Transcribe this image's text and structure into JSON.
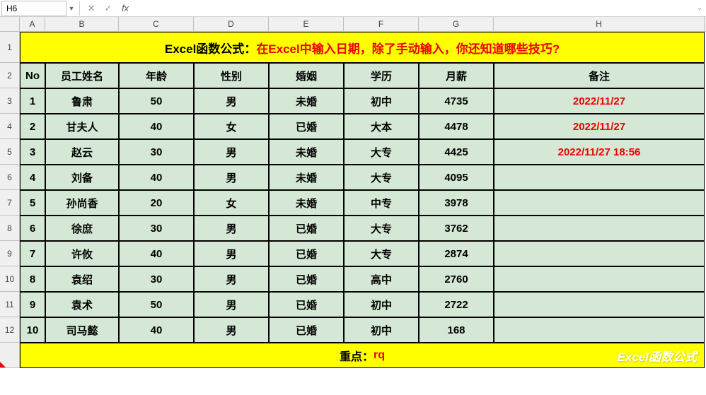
{
  "name_box": "H6",
  "formula": "",
  "col_labels": [
    "A",
    "B",
    "C",
    "D",
    "E",
    "F",
    "G",
    "H"
  ],
  "row_labels": [
    "1",
    "2",
    "3",
    "4",
    "5",
    "6",
    "7",
    "8",
    "9",
    "10",
    "11",
    "12"
  ],
  "title": {
    "prefix": "Excel函数公式：",
    "body": "在Excel中输入日期，除了手动输入，你还知道哪些技巧?"
  },
  "headers": {
    "no": "No",
    "name": "员工姓名",
    "age": "年龄",
    "gender": "性别",
    "marriage": "婚姻",
    "edu": "学历",
    "salary": "月薪",
    "remark": "备注"
  },
  "rows": [
    {
      "no": "1",
      "name": "鲁肃",
      "age": "50",
      "gender": "男",
      "marriage": "未婚",
      "edu": "初中",
      "salary": "4735",
      "remark": "2022/11/27"
    },
    {
      "no": "2",
      "name": "甘夫人",
      "age": "40",
      "gender": "女",
      "marriage": "已婚",
      "edu": "大本",
      "salary": "4478",
      "remark": "2022/11/27"
    },
    {
      "no": "3",
      "name": "赵云",
      "age": "30",
      "gender": "男",
      "marriage": "未婚",
      "edu": "大专",
      "salary": "4425",
      "remark": "2022/11/27 18:56"
    },
    {
      "no": "4",
      "name": "刘备",
      "age": "40",
      "gender": "男",
      "marriage": "未婚",
      "edu": "大专",
      "salary": "4095",
      "remark": ""
    },
    {
      "no": "5",
      "name": "孙尚香",
      "age": "20",
      "gender": "女",
      "marriage": "未婚",
      "edu": "中专",
      "salary": "3978",
      "remark": ""
    },
    {
      "no": "6",
      "name": "徐庶",
      "age": "30",
      "gender": "男",
      "marriage": "已婚",
      "edu": "大专",
      "salary": "3762",
      "remark": ""
    },
    {
      "no": "7",
      "name": "许攸",
      "age": "40",
      "gender": "男",
      "marriage": "已婚",
      "edu": "大专",
      "salary": "2874",
      "remark": ""
    },
    {
      "no": "8",
      "name": "袁绍",
      "age": "30",
      "gender": "男",
      "marriage": "已婚",
      "edu": "高中",
      "salary": "2760",
      "remark": ""
    },
    {
      "no": "9",
      "name": "袁术",
      "age": "50",
      "gender": "男",
      "marriage": "已婚",
      "edu": "初中",
      "salary": "2722",
      "remark": ""
    },
    {
      "no": "10",
      "name": "司马懿",
      "age": "40",
      "gender": "男",
      "marriage": "已婚",
      "edu": "初中",
      "salary": "168",
      "remark": ""
    }
  ],
  "footer": {
    "label": "重点：",
    "value": "rq"
  },
  "watermark": "Excel函数公式"
}
